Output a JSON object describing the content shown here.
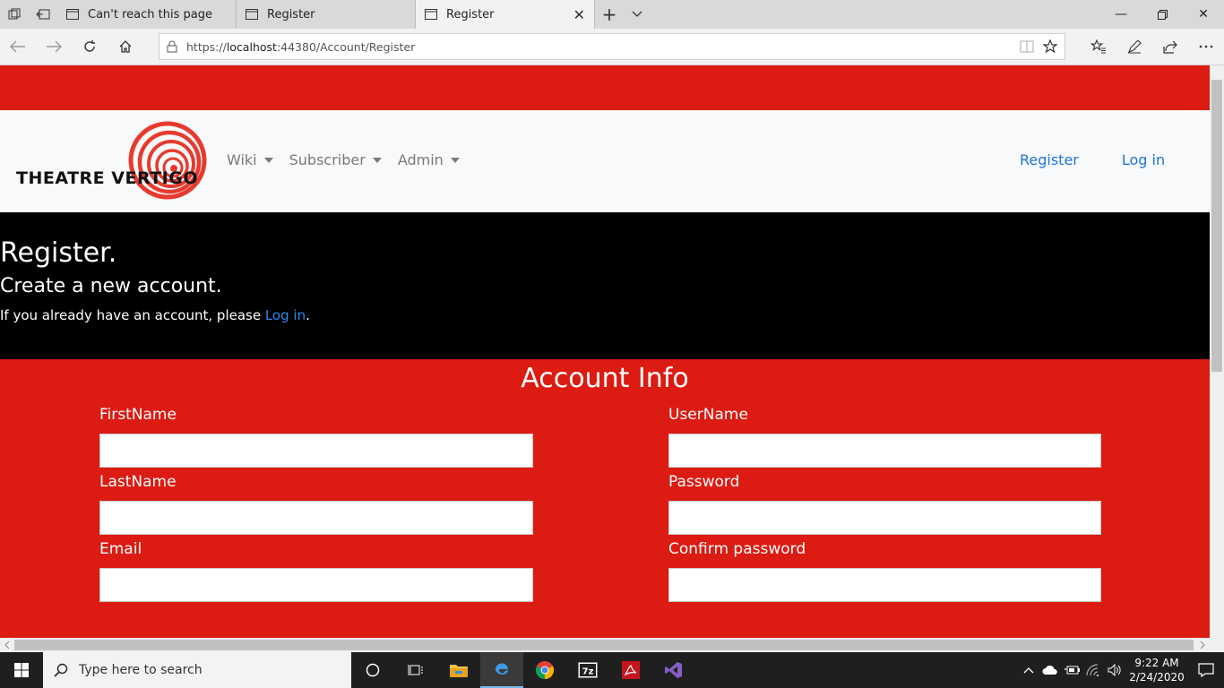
{
  "browser": {
    "tabs": [
      {
        "label": "Can't reach this page",
        "active": false
      },
      {
        "label": "Register",
        "active": false
      },
      {
        "label": "Register",
        "active": true
      }
    ],
    "address": {
      "scheme": "https://",
      "host": "localhost",
      "path": ":44380/Account/Register"
    }
  },
  "site": {
    "logo_text": "THEATRE VERTIGO",
    "menu": [
      "Wiki",
      "Subscriber",
      "Admin"
    ],
    "auth": {
      "register": "Register",
      "login": "Log in"
    },
    "colors": {
      "brand_red": "#dc1b12",
      "link_blue": "#1f74d4"
    }
  },
  "page": {
    "title": "Register.",
    "subtitle": "Create a new account.",
    "login_prompt_prefix": "If you already have an account, please ",
    "login_prompt_link": "Log in",
    "login_prompt_suffix": ".",
    "form_title": "Account Info",
    "left_fields": [
      {
        "label": "FirstName",
        "value": ""
      },
      {
        "label": "LastName",
        "value": ""
      },
      {
        "label": "Email",
        "value": ""
      }
    ],
    "right_fields": [
      {
        "label": "UserName",
        "value": ""
      },
      {
        "label": "Password",
        "value": ""
      },
      {
        "label": "Confirm password",
        "value": ""
      }
    ]
  },
  "taskbar": {
    "search_placeholder": "Type here to search",
    "time": "9:22 AM",
    "date": "2/24/2020"
  }
}
